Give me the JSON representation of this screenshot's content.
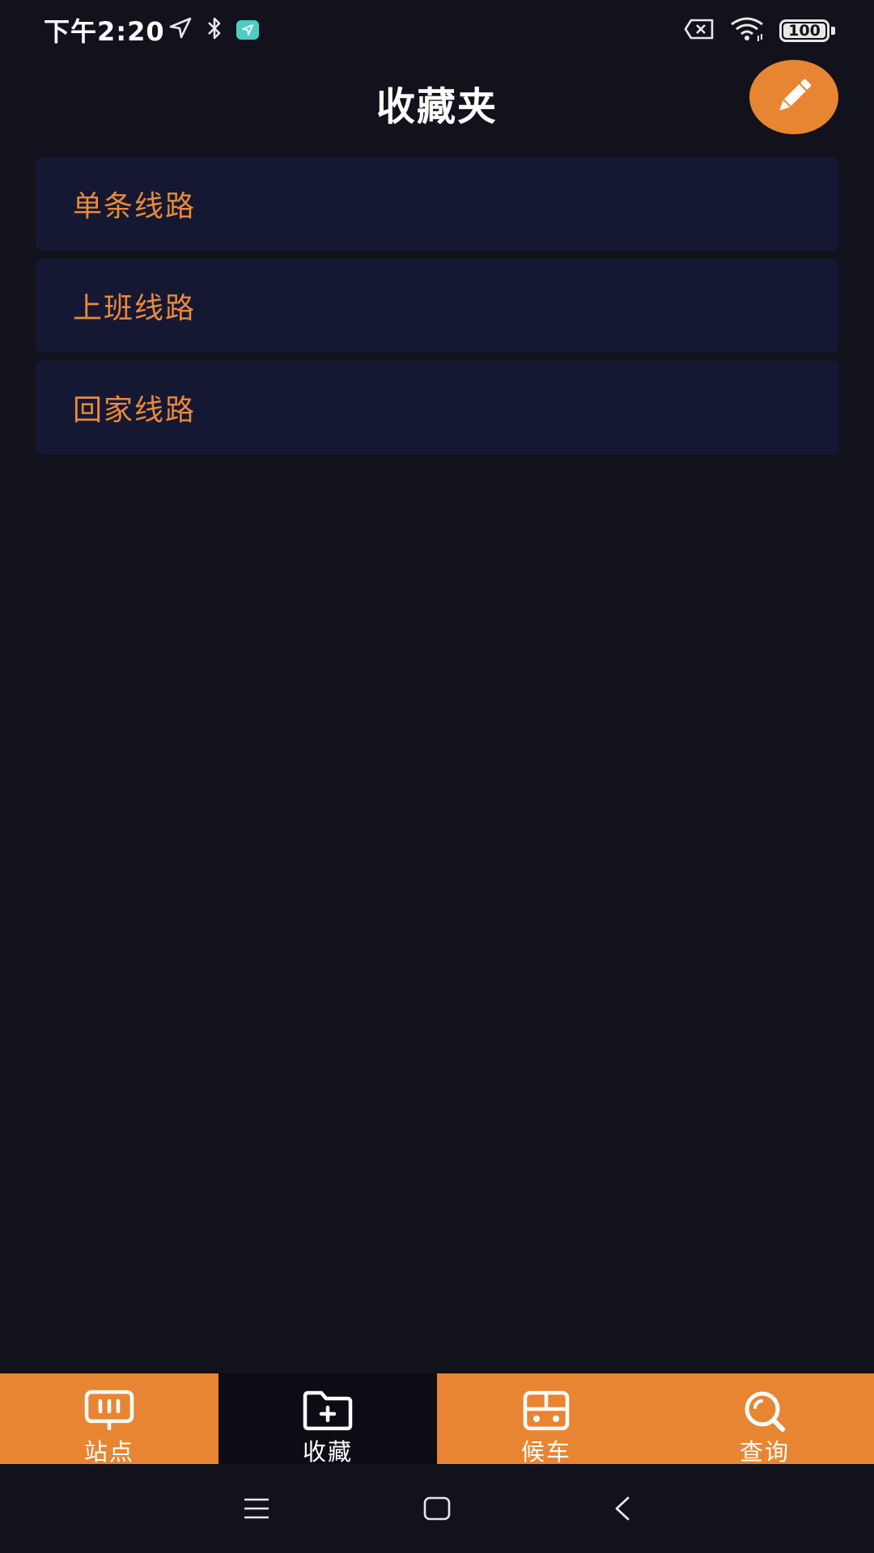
{
  "status_bar": {
    "time": "下午2:20",
    "battery_level": "100",
    "app_badge_color": "#4ecdc4"
  },
  "header": {
    "title": "收藏夹",
    "edit_icon": "pencil-icon"
  },
  "folders": [
    {
      "label": "单条线路"
    },
    {
      "label": "上班线路"
    },
    {
      "label": "回家线路"
    }
  ],
  "tabs": [
    {
      "label": "站点",
      "icon": "bus-stop-sign-icon",
      "active": false
    },
    {
      "label": "收藏",
      "icon": "folder-add-icon",
      "active": true
    },
    {
      "label": "候车",
      "icon": "bus-front-icon",
      "active": false
    },
    {
      "label": "查询",
      "icon": "search-icon",
      "active": false
    }
  ],
  "colors": {
    "background": "#12121c",
    "accent": "#e88532",
    "card": "#151833",
    "folder_text": "#e88a3a",
    "active_tab": "#0c0c14"
  }
}
